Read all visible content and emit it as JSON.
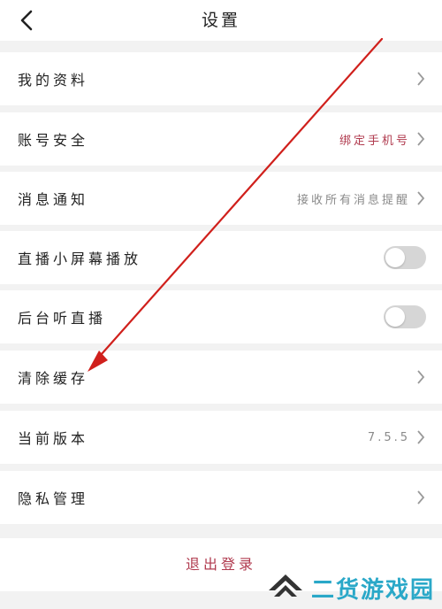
{
  "header": {
    "title": "设置"
  },
  "rows": [
    {
      "label": "我的资料"
    },
    {
      "label": "账号安全",
      "value": "绑定手机号"
    },
    {
      "label": "消息通知",
      "value": "接收所有消息提醒"
    },
    {
      "label": "直播小屏幕播放",
      "toggle": false
    },
    {
      "label": "后台听直播",
      "toggle": false
    },
    {
      "label": "清除缓存"
    },
    {
      "label": "当前版本",
      "value": "7.5.5"
    },
    {
      "label": "隐私管理"
    }
  ],
  "logout": {
    "label": "退出登录"
  },
  "watermark": {
    "text": "二货游戏园"
  },
  "colors": {
    "accent": "#b03a4e",
    "annotation_arrow": "#d0201c",
    "watermark": "#2aa8c8"
  },
  "icons": {
    "back": "chevron-left-icon",
    "row": "chevron-right-icon"
  }
}
